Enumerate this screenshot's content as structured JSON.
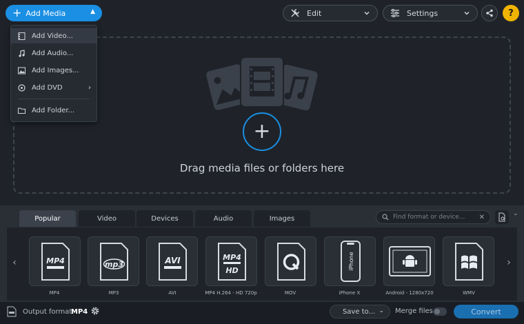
{
  "topbar": {
    "add_media_label": "Add Media",
    "edit_label": "Edit",
    "settings_label": "Settings",
    "help_label": "?"
  },
  "add_menu": {
    "items": [
      {
        "label": "Add Video...",
        "icon": "film-icon"
      },
      {
        "label": "Add Audio...",
        "icon": "music-note-icon"
      },
      {
        "label": "Add Images...",
        "icon": "image-icon"
      },
      {
        "label": "Add DVD",
        "icon": "disc-icon",
        "submenu_arrow": "›"
      },
      {
        "label": "Add Folder...",
        "icon": "folder-icon"
      }
    ]
  },
  "dropzone": {
    "plus": "+",
    "message": "Drag media files or folders here"
  },
  "format_tabs": [
    "Popular",
    "Video",
    "Devices",
    "Audio",
    "Images"
  ],
  "active_tab": "Popular",
  "format_search": {
    "placeholder": "Find format or device...",
    "clear": "✕"
  },
  "formats": [
    {
      "label": "MP4",
      "badge": "MP4"
    },
    {
      "label": "MP3",
      "badge": "mp3"
    },
    {
      "label": "AVI",
      "badge": "AVI"
    },
    {
      "label": "MP4 H.264 - HD 720p",
      "badge": "MP4",
      "badge2": "HD"
    },
    {
      "label": "MOV",
      "badge": "Q"
    },
    {
      "label": "iPhone X",
      "badge": "iPhone"
    },
    {
      "label": "Android - 1280x720",
      "badge": ""
    },
    {
      "label": "WMV",
      "badge": ""
    }
  ],
  "nav": {
    "prev": "‹",
    "next": "›",
    "collapse": "⌄"
  },
  "footer": {
    "output_format_label": "Output format:",
    "output_format_value": "MP4",
    "save_to_label": "Save to...",
    "merge_files_label": "Merge files:",
    "convert_label": "Convert"
  },
  "colors": {
    "accent": "#1a8fe3",
    "help": "#f0b400",
    "background": "#1f2329"
  }
}
